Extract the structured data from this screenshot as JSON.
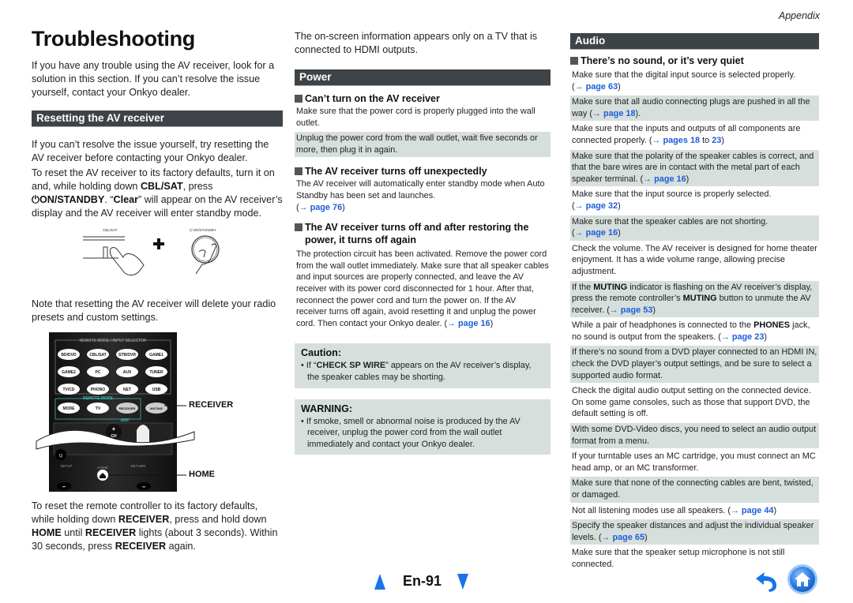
{
  "header": {
    "section": "Appendix"
  },
  "col1": {
    "title": "Troubleshooting",
    "intro": "If you have any trouble using the AV receiver, look for a solution in this section. If you can’t resolve the issue yourself, contact your Onkyo dealer.",
    "reset_section": {
      "title": "Resetting the AV receiver",
      "p1": "If you can’t resolve the issue yourself, try resetting the AV receiver before contacting your Onkyo dealer.",
      "p2_a": "To reset the AV receiver to its factory defaults, turn it on and, while holding down ",
      "p2_b": "CBL/SAT",
      "p2_c": ", press ",
      "p2_d": "⏻ON/STANDBY",
      "p2_e": ". “",
      "p2_f": "Clear",
      "p2_g": "” will appear on the AV receiver’s display and the AV receiver will enter standby mode.",
      "illus_label_left": "CBL/SAT",
      "illus_label_right": "⏻ ON/STANDBY",
      "note": "Note that resetting the AV receiver will delete your radio presets and custom settings.",
      "remote": {
        "group_label": "REMOTE MODE / INPUT SELECTOR",
        "buttons": [
          "BD/DVD",
          "CBL/SAT",
          "STB/DVR",
          "GAME1",
          "GAME2",
          "PC",
          "AUX",
          "TUNER",
          "TV/CD",
          "PHONO",
          "NET",
          "USB"
        ],
        "mode_label": "REMOTE MODE",
        "mode_buttons": [
          "MODE",
          "TV",
          "RECEIVER",
          "MUTING"
        ],
        "amp_label": "AMP",
        "ch_label": "CH",
        "setup_label": "SETUP",
        "home_label": "HOME",
        "return_label": "RETURN",
        "callout_receiver": "RECEIVER",
        "callout_home": "HOME"
      },
      "p3_a": "To reset the remote controller to its factory defaults, while holding down ",
      "p3_b": "RECEIVER",
      "p3_c": ", press and hold down ",
      "p3_d": "HOME",
      "p3_e": " until ",
      "p3_f": "RECEIVER",
      "p3_g": " lights (about 3 seconds). Within 30 seconds, press ",
      "p3_h": "RECEIVER",
      "p3_i": " again."
    }
  },
  "col2": {
    "intro": "The on-screen information appears only on a TV that is connected to HDMI outputs.",
    "power_section": {
      "title": "Power",
      "q1": {
        "heading": "Can’t turn on the AV receiver",
        "a1": "Make sure that the power cord is properly plugged into the wall outlet.",
        "a2": "Unplug the power cord from the wall outlet, wait five seconds or more, then plug it in again."
      },
      "q2": {
        "heading": "The AV receiver turns off unexpectedly",
        "a1": "The AV receiver will automatically enter standby mode when Auto Standby has been set and launches.",
        "link": "page 76"
      },
      "q3": {
        "heading": "The AV receiver turns off and after restoring the power, it turns off again",
        "a1": "The protection circuit has been activated. Remove the power cord from the wall outlet immediately. Make sure that all speaker cables and input sources are properly connected, and leave the AV receiver with its power cord disconnected for 1 hour. After that, reconnect the power cord and turn the power on. If the AV receiver turns off again, avoid resetting it and unplug the power cord. Then contact your Onkyo dealer.",
        "link": "page 16"
      }
    },
    "caution": {
      "title": "Caution:",
      "item_a": "• If “",
      "item_b": "CHECK SP WIRE",
      "item_c": "” appears on the AV receiver’s display, the speaker cables may be shorting."
    },
    "warning": {
      "title": "WARNING:",
      "item": "• If smoke, smell or abnormal noise is produced by the AV receiver, unplug the power cord from the wall outlet immediately and contact your Onkyo dealer."
    }
  },
  "col3": {
    "audio_section": {
      "title": "Audio",
      "heading": "There’s no sound, or it’s very quiet",
      "items": [
        {
          "text": "Make sure that the digital input source is selected properly.",
          "link": "page 63"
        },
        {
          "text": "Make sure that all audio connecting plugs are pushed in all the way",
          "link": "page 18"
        },
        {
          "text": "Make sure that the inputs and outputs of all components are connected properly.",
          "link": "pages 18",
          "link_mid": " to ",
          "link2": "23"
        },
        {
          "text": "Make sure that the polarity of the speaker cables is correct, and that the bare wires are in contact with the metal part of each speaker terminal.",
          "link": "page 16"
        },
        {
          "text": "Make sure that the input source is properly selected.",
          "link": "page 32"
        },
        {
          "text": "Make sure that the speaker cables are not shorting.",
          "link": "page 16"
        },
        {
          "text": "Check the volume. The AV receiver is designed for home theater enjoyment. It has a wide volume range, allowing precise adjustment."
        },
        {
          "text_a": "If the ",
          "text_b": "MUTING",
          "text_c": " indicator is flashing on the AV receiver’s display, press the remote controller’s ",
          "text_d": "MUTING",
          "text_e": " button to unmute the AV receiver.",
          "link": "page 53"
        },
        {
          "text_a": "While a pair of headphones is connected to the ",
          "text_b": "PHONES",
          "text_c": " jack, no sound is output from the speakers.",
          "link": "page 23"
        },
        {
          "text": "If there’s no sound from a DVD player connected to an HDMI IN, check the DVD player’s output settings, and be sure to select a supported audio format."
        },
        {
          "text": "Check the digital audio output setting on the connected device. On some game consoles, such as those that support DVD, the default setting is off."
        },
        {
          "text": "With some DVD-Video discs, you need to select an audio output format from a menu."
        },
        {
          "text": "If your turntable uses an MC cartridge, you must connect an MC head amp, or an MC transformer."
        },
        {
          "text": "Make sure that none of the connecting cables are bent, twisted, or damaged."
        },
        {
          "text": "Not all listening modes use all speakers.",
          "link": "page 44"
        },
        {
          "text": "Specify the speaker distances and adjust the individual speaker levels.",
          "link": "page 65"
        },
        {
          "text": "Make sure that the speaker setup microphone is not still connected."
        }
      ]
    }
  },
  "footer": {
    "page_number": "En-91",
    "arrow_glyph": "→",
    "colors": {
      "nav_blue": "#1874e8",
      "link_blue": "#1e5eda",
      "bar_dark": "#3d4346",
      "shade": "#d6dfdc"
    }
  }
}
